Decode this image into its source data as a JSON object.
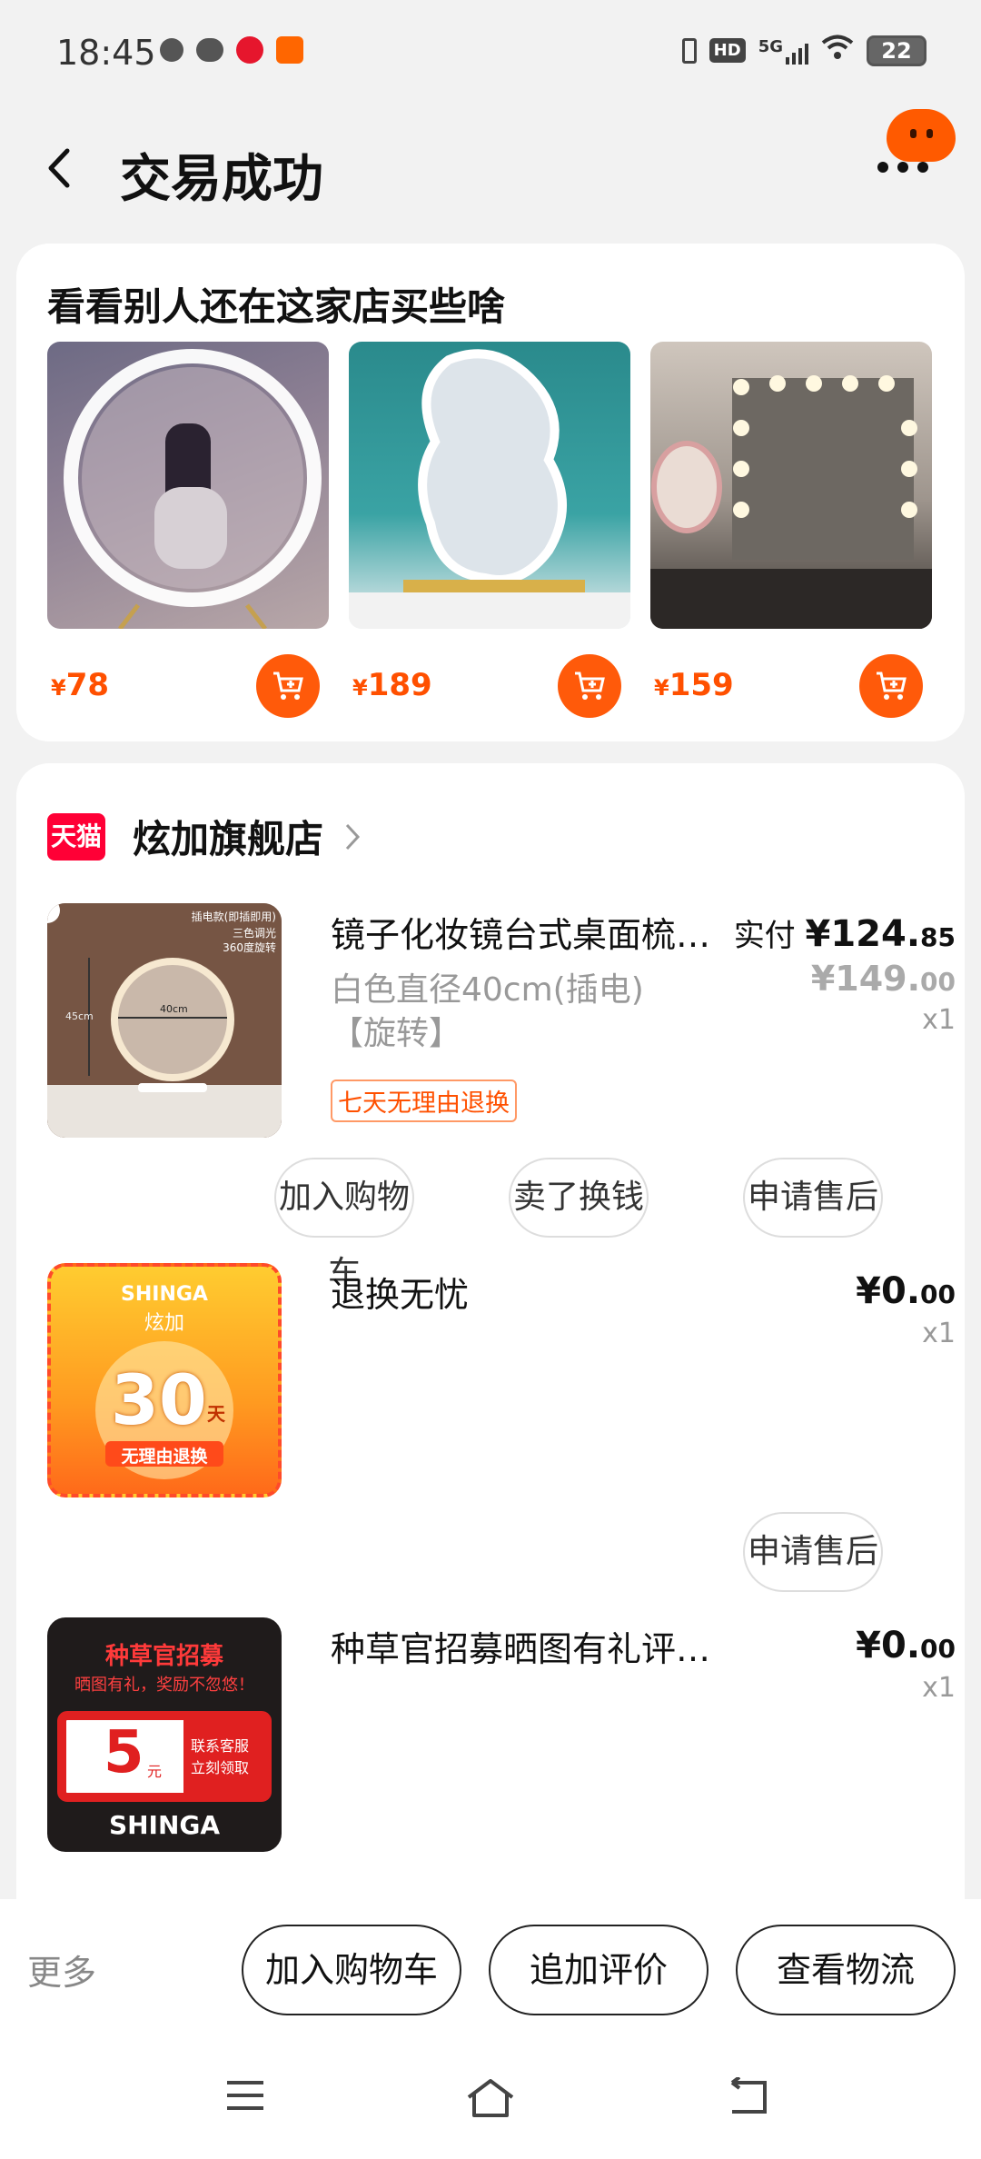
{
  "status_bar": {
    "time": "18:45",
    "network": "5G",
    "hd": "HD",
    "battery": "22"
  },
  "header": {
    "title": "交易成功"
  },
  "recommend": {
    "title": "看看别人还在这家店买些啥",
    "currency": "¥",
    "items": [
      {
        "price": "78",
        "image": "round-led-mirror"
      },
      {
        "price": "189",
        "image": "cloud-led-mirror"
      },
      {
        "price": "159",
        "image": "hollywood-mirror"
      }
    ]
  },
  "shop": {
    "badge": "天猫",
    "name": "炫加旗舰店"
  },
  "items": [
    {
      "name": "镜子化妆镜台式桌面梳…",
      "sku_line1": "白色直径40cm(插电)",
      "sku_line2": "【旋转】",
      "tag": "七天无理由退换",
      "pay_label": "实付",
      "pay_int": "¥124.",
      "pay_dec": "85",
      "orig_int": "¥149.",
      "orig_dec": "00",
      "qty": "x1",
      "buttons": [
        "加入购物车",
        "卖了换钱",
        "申请售后"
      ],
      "thumb_text": {
        "line1": "插电款(即插即用)",
        "line2": "三色调光",
        "line3": "360度旋转",
        "size": "40cm",
        "side": "45cm"
      }
    },
    {
      "name": "退换无忧",
      "price_int": "¥0.",
      "price_dec": "00",
      "qty": "x1",
      "buttons": [
        "申请售后"
      ],
      "thumb_text": {
        "brand": "SHINGA",
        "brand_cn": "炫加",
        "days": "30",
        "days_unit": "天",
        "caption": "无理由退换"
      }
    },
    {
      "name": "种草官招募晒图有礼评价后联…",
      "price_int": "¥0.",
      "price_dec": "00",
      "qty": "x1",
      "thumb_text": {
        "title": "种草官招募",
        "sub": "晒图有礼，奖励不忽悠！",
        "amount": "5",
        "unit": "元",
        "side1": "联系客服",
        "side2": "立刻领取",
        "brand": "SHINGA"
      }
    }
  ],
  "bottom_bar": {
    "more": "更多",
    "buttons": [
      "加入购物车",
      "追加评价",
      "查看物流"
    ]
  },
  "colors": {
    "accent": "#ff5000",
    "tmall": "#ff0036",
    "background": "#f2f2f2"
  }
}
